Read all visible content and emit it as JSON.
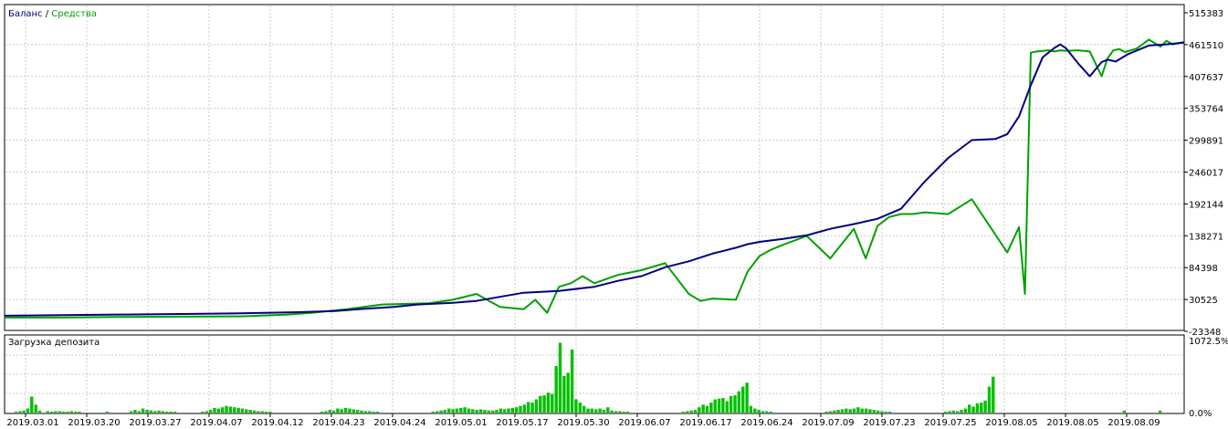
{
  "chart_data": [
    {
      "type": "line",
      "legend": {
        "balance": "Баланс",
        "separator": " / ",
        "equity": "Средства",
        "placement": "top-left"
      },
      "colors": {
        "balance": "#00007f",
        "equity": "#00a000",
        "grid": "#c8c8c8",
        "frame": "#000000"
      },
      "grid": true,
      "ylim": [
        -23348,
        515383
      ],
      "y_ticks": [
        "515383",
        "461510",
        "407637",
        "353764",
        "299891",
        "246017",
        "192144",
        "138271",
        "84398",
        "30525",
        "-23348"
      ],
      "x_ticks": [
        "2019.03.01",
        "2019.03.20",
        "2019.03.27",
        "2019.04.07",
        "2019.04.12",
        "2019.04.23",
        "2019.04.24",
        "2019.05.01",
        "2019.05.17",
        "2019.05.30",
        "2019.06.07",
        "2019.06.17",
        "2019.06.24",
        "2019.07.09",
        "2019.07.23",
        "2019.07.25",
        "2019.08.05",
        "2019.08.05",
        "2019.08.09"
      ],
      "x_range": [
        0,
        1000
      ],
      "series": [
        {
          "name": "Баланс",
          "x": [
            0,
            50,
            100,
            150,
            200,
            250,
            280,
            300,
            330,
            350,
            380,
            400,
            420,
            440,
            470,
            500,
            520,
            540,
            560,
            580,
            600,
            610,
            620,
            630,
            640,
            660,
            680,
            700,
            720,
            740,
            760,
            780,
            800,
            820,
            840,
            850,
            860,
            870,
            880,
            890,
            895,
            900,
            910,
            920,
            930,
            935,
            942,
            952,
            970,
            985,
            1000
          ],
          "y": [
            3000,
            4000,
            5000,
            6000,
            7000,
            9000,
            11000,
            14000,
            18000,
            22000,
            25000,
            28000,
            35000,
            42000,
            45000,
            52000,
            62000,
            70000,
            85000,
            95000,
            108000,
            113000,
            118000,
            124000,
            128000,
            133000,
            139000,
            150000,
            158000,
            167000,
            184000,
            230000,
            270000,
            300000,
            302000,
            310000,
            340000,
            393000,
            440000,
            456000,
            462000,
            455000,
            430000,
            408000,
            432000,
            436000,
            433000,
            445000,
            460000,
            462000,
            465000
          ]
        },
        {
          "name": "Средства",
          "x": [
            0,
            50,
            100,
            150,
            200,
            240,
            260,
            290,
            320,
            360,
            380,
            400,
            420,
            440,
            450,
            460,
            470,
            480,
            490,
            500,
            520,
            540,
            560,
            580,
            590,
            600,
            620,
            630,
            640,
            650,
            660,
            680,
            700,
            720,
            730,
            740,
            750,
            760,
            770,
            780,
            800,
            820,
            840,
            850,
            860,
            865,
            870,
            875,
            880,
            885,
            890,
            895,
            900,
            910,
            920,
            930,
            935,
            940,
            945,
            950,
            960,
            970,
            980,
            985,
            990,
            1000
          ],
          "y": [
            0,
            0,
            1000,
            1500,
            2000,
            5000,
            8000,
            14000,
            22000,
            24000,
            30000,
            40000,
            18000,
            14000,
            30000,
            8000,
            52000,
            58000,
            70000,
            58000,
            72000,
            80000,
            92000,
            40000,
            28000,
            32000,
            30000,
            78000,
            104000,
            115000,
            123000,
            138000,
            100000,
            150000,
            100000,
            155000,
            170000,
            175000,
            175000,
            178000,
            175000,
            200000,
            140000,
            110000,
            153000,
            40000,
            448000,
            450000,
            451000,
            452000,
            450000,
            452000,
            451000,
            452000,
            450000,
            408000,
            438000,
            452000,
            454000,
            449000,
            455000,
            470000,
            458000,
            468000,
            462000,
            466000
          ]
        }
      ]
    },
    {
      "type": "bar",
      "title": "Загрузка депозита",
      "colors": {
        "bar": "#00c000"
      },
      "ylim": [
        0,
        1072.5
      ],
      "y_ticks": [
        "1072.5%",
        "0.0%"
      ],
      "values": [
        0,
        0,
        10,
        20,
        30,
        60,
        240,
        120,
        30,
        0,
        20,
        10,
        20,
        20,
        10,
        10,
        20,
        10,
        10,
        0,
        0,
        0,
        0,
        0,
        0,
        10,
        0,
        0,
        0,
        0,
        0,
        20,
        40,
        20,
        60,
        40,
        30,
        20,
        30,
        20,
        10,
        10,
        10,
        0,
        0,
        0,
        0,
        0,
        0,
        10,
        20,
        40,
        70,
        60,
        80,
        100,
        90,
        80,
        70,
        60,
        50,
        40,
        30,
        20,
        20,
        10,
        10,
        0,
        0,
        0,
        0,
        0,
        0,
        0,
        0,
        0,
        0,
        0,
        0,
        10,
        20,
        40,
        30,
        60,
        50,
        70,
        60,
        50,
        40,
        30,
        20,
        20,
        10,
        10,
        0,
        0,
        0,
        0,
        0,
        0,
        0,
        0,
        0,
        0,
        0,
        0,
        0,
        10,
        20,
        30,
        40,
        60,
        50,
        60,
        70,
        80,
        60,
        50,
        40,
        50,
        40,
        30,
        30,
        40,
        60,
        50,
        60,
        70,
        80,
        100,
        120,
        160,
        150,
        200,
        250,
        260,
        300,
        280,
        700,
        1050,
        550,
        600,
        950,
        200,
        150,
        100,
        60,
        60,
        50,
        60,
        40,
        80,
        30,
        20,
        20,
        10,
        10,
        0,
        0,
        0,
        0,
        0,
        0,
        0,
        0,
        0,
        0,
        0,
        0,
        0,
        10,
        20,
        30,
        40,
        80,
        120,
        100,
        150,
        200,
        210,
        220,
        170,
        250,
        260,
        320,
        390,
        450,
        100,
        60,
        40,
        20,
        20,
        10,
        0,
        0,
        0,
        0,
        0,
        0,
        0,
        0,
        0,
        0,
        0,
        0,
        0,
        10,
        20,
        30,
        40,
        50,
        60,
        50,
        60,
        80,
        60,
        60,
        50,
        40,
        30,
        20,
        10,
        10,
        0,
        0,
        0,
        0,
        0,
        0,
        0,
        0,
        0,
        0,
        0,
        0,
        0,
        10,
        20,
        30,
        20,
        40,
        60,
        120,
        90,
        140,
        150,
        180,
        390,
        540,
        0,
        0,
        0,
        0,
        0,
        0,
        0,
        0,
        0,
        0,
        0,
        0,
        0,
        0,
        0,
        0,
        0,
        0,
        0,
        0,
        0,
        0,
        0,
        0,
        0,
        0,
        0,
        0,
        0,
        0,
        0,
        0,
        30,
        0,
        0,
        0,
        0,
        0,
        0,
        0,
        0,
        30,
        0,
        0,
        0,
        0,
        0
      ]
    }
  ]
}
